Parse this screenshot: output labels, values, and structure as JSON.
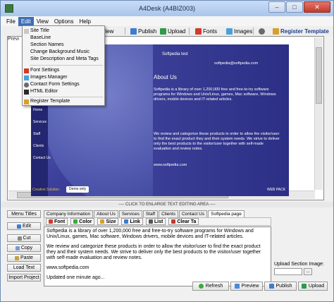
{
  "window": {
    "title": "A4Desk (A4BIZ003)",
    "controls": [
      "–",
      "□",
      "✕"
    ]
  },
  "menubar": [
    {
      "label": "File"
    },
    {
      "label": "Edit"
    },
    {
      "label": "View"
    },
    {
      "label": "Options"
    },
    {
      "label": "Help"
    }
  ],
  "toolbar": {
    "preview_label": "Preview",
    "publish_label": "Publish",
    "upload_label": "Upload",
    "fonts_label": "Fonts",
    "images_label": "Images",
    "register_label": "Register Template"
  },
  "preview_pane_label": "Previ",
  "edit_menu": {
    "items": [
      {
        "label": "Site Title"
      },
      {
        "label": "BaseLine"
      },
      {
        "label": "Section Names"
      },
      {
        "label": "Change Background Music"
      },
      {
        "label": "Site Description and Meta Tags"
      },
      {
        "label": "Font Settings"
      },
      {
        "label": "Images Manager"
      },
      {
        "label": "Contact Form Settings"
      },
      {
        "label": "HTML Editor"
      },
      {
        "label": "Register Template"
      }
    ]
  },
  "site_preview": {
    "site_title": "Softpedia test",
    "email": "softpedia@softpedia.com",
    "heading": "About Us",
    "paragraph1": "Softpedia is a library of over 1,200,000 free and free-to-try software programs for Windows and Unix/Linux, games, Mac software, Windows drivers, mobile devices and IT-related articles.",
    "paragraph2": "We review and categorize these products in order to allow the visitor/user to find the exact product they and their system needs. We strive to deliver only the best products to the visitor/user together with self-made evaluation and review notes.",
    "url": "www.softpedia.com",
    "nav": [
      "Home",
      "Services",
      "Staff",
      "Clients",
      "Contact Us"
    ],
    "demo_label": "Demo only",
    "footer_left": "Creative Solution",
    "footer_right": "WEB PACK"
  },
  "enlarge_bar": "---- CLICK TO ENLARGE TEXT EDITING AREA ----",
  "left_buttons": {
    "menu_titles": "Menu Titles",
    "edit": "Edit",
    "cut": "Cut",
    "copy": "Copy",
    "paste": "Paste",
    "load_text": "Load Text",
    "import_project": "Import Project"
  },
  "tabs": [
    {
      "label": "Company Information"
    },
    {
      "label": "About Us"
    },
    {
      "label": "Services"
    },
    {
      "label": "Staff"
    },
    {
      "label": "Clients"
    },
    {
      "label": "Contact Us"
    },
    {
      "label": "Softpedia page"
    }
  ],
  "editor_toolbar": {
    "font": "Font",
    "color": "Color",
    "size": "Size",
    "link": "Link",
    "list": "List",
    "clear": "Clear Ta"
  },
  "editor_content": {
    "p1": "Softpedia is a library of over 1,200,000 free and free-to-try software programs for Windows and Unix/Linux, games, Mac software, Windows drivers, mobile devices and IT-related articles.",
    "p2": "We review and categorize these products in order to allow the visitor/user to find the exact product they and their system needs. We strive to deliver only the best products to the visitor/user together with self-made evaluation and review notes.",
    "p3": "www.softpedia.com",
    "p4": "Updated one minute ago..."
  },
  "upload_section": {
    "label": "Upload Section Image:",
    "browse": "..."
  },
  "bottom_buttons": {
    "refresh": "Refresh",
    "preview": "Preview",
    "publish": "Publish",
    "upload": "Upload"
  },
  "colors": {
    "titlebar": "#b5cdee",
    "menu_active": "#3c6fb7",
    "site_bg": "#3c3f9a"
  }
}
